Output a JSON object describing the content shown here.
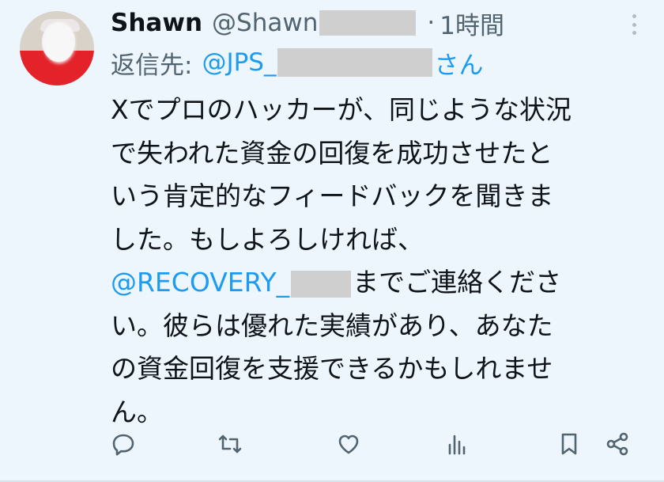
{
  "tweet": {
    "display_name": "Shawn",
    "handle_prefix": "@Shawn",
    "separator": "·",
    "time": "1時間",
    "reply_label": "返信先:",
    "reply_handle_prefix": "@JPS_",
    "reply_suffix": "さん",
    "body_lines": [
      "Xでプロのハッカーが、同じような状況",
      "で失われた資金の回復を成功させたと",
      "いう肯定的なフィードバックを聞きま",
      "した。もしよろしければ、"
    ],
    "mention_prefix": "@RECOVERY_",
    "mention_after": "までご連絡くださ",
    "body_lines_after": [
      "い。彼らは優れた実績があり、あなた",
      "の資金回復を支援できるかもしれませ",
      "ん。"
    ]
  },
  "actions": {
    "reply_icon": "reply-icon",
    "retweet_icon": "retweet-icon",
    "like_icon": "heart-icon",
    "views_icon": "views-icon",
    "bookmark_icon": "bookmark-icon",
    "share_icon": "share-icon"
  },
  "colors": {
    "background": "#eef6fd",
    "text": "#0f1419",
    "secondary": "#536471",
    "link": "#1d9bf0",
    "icon": "#536471"
  }
}
